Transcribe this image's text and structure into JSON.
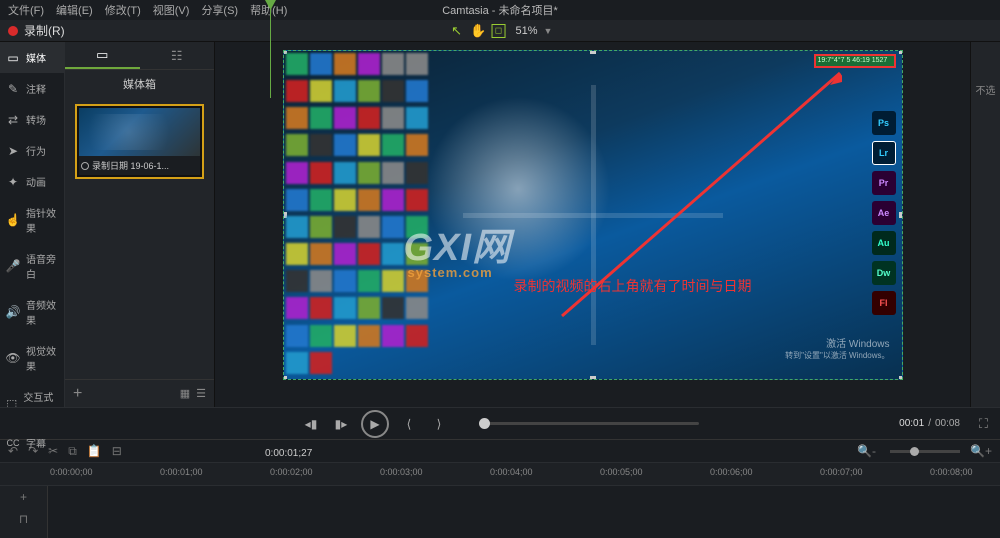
{
  "app": {
    "title": "Camtasia - 未命名项目*"
  },
  "menu": {
    "items": [
      "文件(F)",
      "编辑(E)",
      "修改(T)",
      "视图(V)",
      "分享(S)",
      "帮助(H)"
    ]
  },
  "record": {
    "label": "录制(R)"
  },
  "toolbar": {
    "zoom": "51%"
  },
  "sidebar": {
    "items": [
      {
        "icon": "▭",
        "label": "媒体"
      },
      {
        "icon": "✎",
        "label": "注释"
      },
      {
        "icon": "⇄",
        "label": "转场"
      },
      {
        "icon": "➤",
        "label": "行为"
      },
      {
        "icon": "✦",
        "label": "动画"
      },
      {
        "icon": "☝",
        "label": "指针效果"
      },
      {
        "icon": "🎤",
        "label": "语音旁白"
      },
      {
        "icon": "🔊",
        "label": "音频效果"
      },
      {
        "icon": "👁",
        "label": "视觉效果"
      },
      {
        "icon": "⬚",
        "label": "交互式功能"
      },
      {
        "icon": "CC",
        "label": "字幕"
      }
    ]
  },
  "media_panel": {
    "title": "媒体箱",
    "clip_label": "录制日期 19-06-1..."
  },
  "canvas": {
    "watermark_main": "GXI网",
    "watermark_sub": "system.com",
    "annotation": "录制的视频的右上角就有了时间与日期",
    "activate_title": "激活 Windows",
    "activate_sub": "转到\"设置\"以激活 Windows。",
    "right_apps": [
      "Ps",
      "Lr",
      "Pr",
      "Ae",
      "Au",
      "Dw",
      "Fl"
    ],
    "time_box": "19:7°4°7 5  46:19 1527"
  },
  "right_panel": {
    "label": "不选"
  },
  "playback": {
    "current": "00:01",
    "duration": "00:08",
    "sep": "/"
  },
  "timeline": {
    "playhead_time": "0:00:01;27",
    "ticks": [
      "0:00:00;00",
      "0:00:01;00",
      "0:00:02;00",
      "0:00:03;00",
      "0:00:04;00",
      "0:00:05;00",
      "0:00:06;00",
      "0:00:07;00",
      "0:00:08;00"
    ]
  }
}
